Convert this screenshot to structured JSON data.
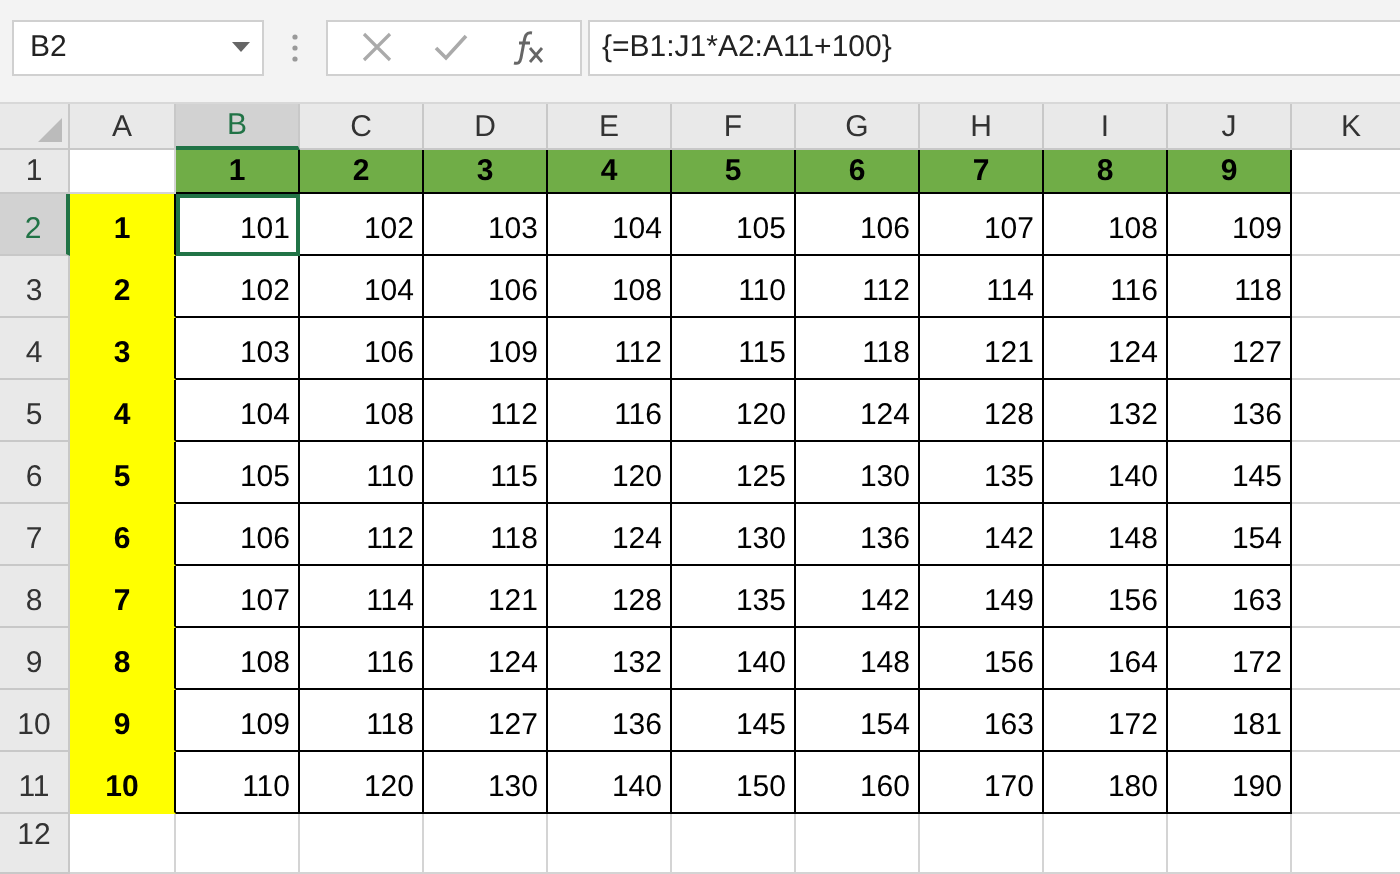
{
  "formula_bar": {
    "name_box": "B2",
    "formula": "{=B1:J1*A2:A11+100}"
  },
  "columns": [
    {
      "label": "A",
      "selected": false
    },
    {
      "label": "B",
      "selected": true
    },
    {
      "label": "C",
      "selected": false
    },
    {
      "label": "D",
      "selected": false
    },
    {
      "label": "E",
      "selected": false
    },
    {
      "label": "F",
      "selected": false
    },
    {
      "label": "G",
      "selected": false
    },
    {
      "label": "H",
      "selected": false
    },
    {
      "label": "I",
      "selected": false
    },
    {
      "label": "J",
      "selected": false
    },
    {
      "label": "K",
      "selected": false
    }
  ],
  "header_row": {
    "label": "1",
    "selected": false,
    "cells": [
      "1",
      "2",
      "3",
      "4",
      "5",
      "6",
      "7",
      "8",
      "9"
    ]
  },
  "rows": [
    {
      "label": "2",
      "selected": true,
      "multiplier": "1",
      "values": [
        "101",
        "102",
        "103",
        "104",
        "105",
        "106",
        "107",
        "108",
        "109"
      ]
    },
    {
      "label": "3",
      "selected": false,
      "multiplier": "2",
      "values": [
        "102",
        "104",
        "106",
        "108",
        "110",
        "112",
        "114",
        "116",
        "118"
      ]
    },
    {
      "label": "4",
      "selected": false,
      "multiplier": "3",
      "values": [
        "103",
        "106",
        "109",
        "112",
        "115",
        "118",
        "121",
        "124",
        "127"
      ]
    },
    {
      "label": "5",
      "selected": false,
      "multiplier": "4",
      "values": [
        "104",
        "108",
        "112",
        "116",
        "120",
        "124",
        "128",
        "132",
        "136"
      ]
    },
    {
      "label": "6",
      "selected": false,
      "multiplier": "5",
      "values": [
        "105",
        "110",
        "115",
        "120",
        "125",
        "130",
        "135",
        "140",
        "145"
      ]
    },
    {
      "label": "7",
      "selected": false,
      "multiplier": "6",
      "values": [
        "106",
        "112",
        "118",
        "124",
        "130",
        "136",
        "142",
        "148",
        "154"
      ]
    },
    {
      "label": "8",
      "selected": false,
      "multiplier": "7",
      "values": [
        "107",
        "114",
        "121",
        "128",
        "135",
        "142",
        "149",
        "156",
        "163"
      ]
    },
    {
      "label": "9",
      "selected": false,
      "multiplier": "8",
      "values": [
        "108",
        "116",
        "124",
        "132",
        "140",
        "148",
        "156",
        "164",
        "172"
      ]
    },
    {
      "label": "10",
      "selected": false,
      "multiplier": "9",
      "values": [
        "109",
        "118",
        "127",
        "136",
        "145",
        "154",
        "163",
        "172",
        "181"
      ]
    },
    {
      "label": "11",
      "selected": false,
      "multiplier": "10",
      "values": [
        "110",
        "120",
        "130",
        "140",
        "150",
        "160",
        "170",
        "180",
        "190"
      ]
    }
  ],
  "extra_row": {
    "label": "12"
  }
}
